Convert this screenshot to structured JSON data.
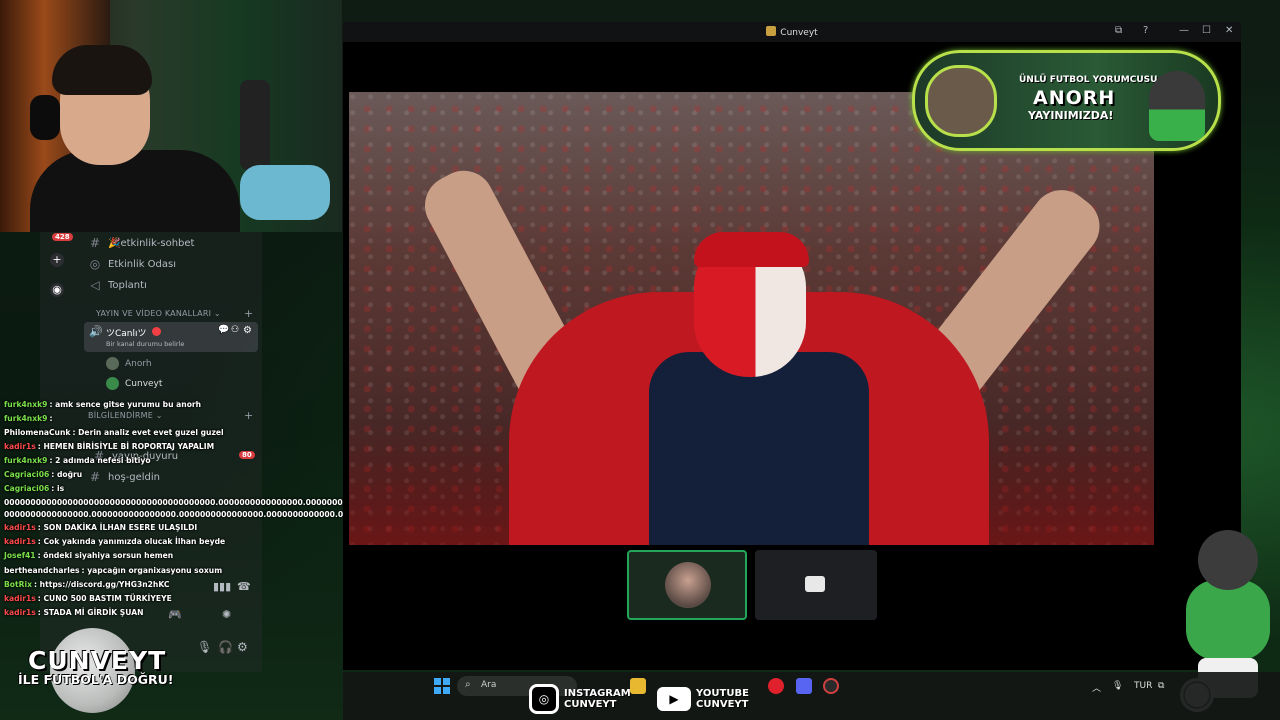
{
  "window": {
    "title": "Cunveyt"
  },
  "sidebar": {
    "badge_top": "428",
    "badge_mid": "80",
    "channels": [
      {
        "icon": "#",
        "label": "🎉etkinlik-sohbet"
      },
      {
        "icon": "◎",
        "label": "Etkinlik Odası"
      },
      {
        "icon": "◁",
        "label": "Toplantı"
      }
    ],
    "category_stream": "YAYIN VE VİDEO KANALLARI",
    "voice_channel": {
      "label": "ツCanlıツ",
      "status": "Bir kanal durumu belirle"
    },
    "voice_users": [
      "Anorh",
      "Cunveyt"
    ],
    "category_info": "BİLGİLENDİRME",
    "channels2": [
      {
        "icon": "#",
        "label": "yayın-duyuru"
      },
      {
        "icon": "#",
        "label": "hoş-geldin"
      }
    ]
  },
  "chat": [
    {
      "user": "furk4nxk9",
      "color": "#7ae04a",
      "msg": "amk sence gitse yurumu bu anorh"
    },
    {
      "user": "furk4nxk9",
      "color": "#7ae04a",
      "msg": ""
    },
    {
      "user": "PhilomenaCunk",
      "color": "#ffffff",
      "msg": "Derin analiz evet evet guzel guzel"
    },
    {
      "user": "kadir1s",
      "color": "#ff4a4a",
      "msg": "HEMEN BİRİSİYLE Bİ ROPORTAJ YAPALIM"
    },
    {
      "user": "furk4nxk9",
      "color": "#7ae04a",
      "msg": "2 adımda nefesi bitiyo"
    },
    {
      "user": "Cagriaci06",
      "color": "#7ae04a",
      "msg": "doğru"
    },
    {
      "user": "Cagriaci06",
      "color": "#7ae04a",
      "msg": "is"
    },
    {
      "user": "",
      "color": "#ffffff",
      "msg": "0000000000000000000000000000000000000000.0000000000000000.0000000000000000.000"
    },
    {
      "user": "",
      "color": "#ffffff",
      "msg": "0000000000000000.0000000000000000.0000000000000000.0000000000000.0"
    },
    {
      "user": "kadir1s",
      "color": "#ff4a4a",
      "msg": "SON DAKİKA İLHAN ESERE ULAŞILDI"
    },
    {
      "user": "kadir1s",
      "color": "#ff4a4a",
      "msg": "Cok yakında yanımızda olucak İlhan beyde"
    },
    {
      "user": "Josef41",
      "color": "#7ae04a",
      "msg": "öndeki siyahiya sorsun hemen"
    },
    {
      "user": "bertheandcharles",
      "color": "#ffffff",
      "msg": "yapcağın organixasyonu soxum"
    },
    {
      "user": "BotRix",
      "color": "#7ae04a",
      "msg": "https://discord.gg/YHG3n2hKC"
    },
    {
      "user": "kadir1s",
      "color": "#ff4a4a",
      "msg": "CUNO 500 BASTIM TÜRKİYEYE"
    },
    {
      "user": "kadir1s",
      "color": "#ff4a4a",
      "msg": "STADA Mİ GİRDİK ŞUAN"
    }
  ],
  "brand": {
    "line1": "CUNVEYT",
    "line2": "İLE FUTBOL'A DOĞRU!"
  },
  "promo": {
    "line1": "ÜNLÜ FUTBOL YORUMCUSU",
    "line2": "ANORH",
    "line3": "YAYINIMIZDA!"
  },
  "taskbar": {
    "search_placeholder": "Ara",
    "instagram": {
      "line1": "INSTAGRAM",
      "line2": "CUNVEYT"
    },
    "youtube": {
      "line1": "YOUTUBE",
      "line2": "CUNVEYT"
    },
    "lang": "TUR"
  },
  "colors": {
    "accent_green": "#23a55a",
    "promo_border": "#b8e04a",
    "live_red": "#f23f43"
  }
}
